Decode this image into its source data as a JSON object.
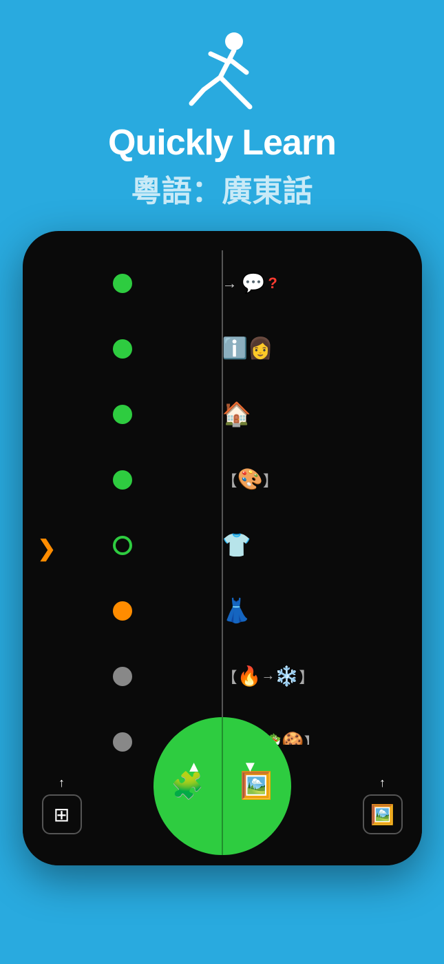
{
  "hero": {
    "title": "Quickly Learn",
    "subtitle": "粵語：廣東話",
    "runner_icon": "🏃"
  },
  "timeline": {
    "items": [
      {
        "id": 1,
        "dot_type": "green-filled",
        "content": "→ 💬 ❓"
      },
      {
        "id": 2,
        "dot_type": "green-filled",
        "content": "ℹ️ 👩"
      },
      {
        "id": 3,
        "dot_type": "green-filled",
        "content": "🏠"
      },
      {
        "id": 4,
        "dot_type": "green-filled",
        "content": "【🎨】"
      },
      {
        "id": 5,
        "dot_type": "green-outline",
        "content": "👕"
      },
      {
        "id": 6,
        "dot_type": "orange",
        "content": "👗"
      },
      {
        "id": 7,
        "dot_type": "gray",
        "content": "【🔥→❄️】"
      },
      {
        "id": 8,
        "dot_type": "gray",
        "content": "【🥗🥗🍪】"
      }
    ]
  },
  "nav": {
    "up_label": "▲",
    "down_label": "▼"
  },
  "bottom_bar": {
    "left_label": "⬆",
    "left_icon": "⊞",
    "right_label": "⬆",
    "right_icon": "🖼",
    "center_left_icon": "🧩",
    "center_right_icon": "🖼"
  },
  "side_arrow": "❯"
}
